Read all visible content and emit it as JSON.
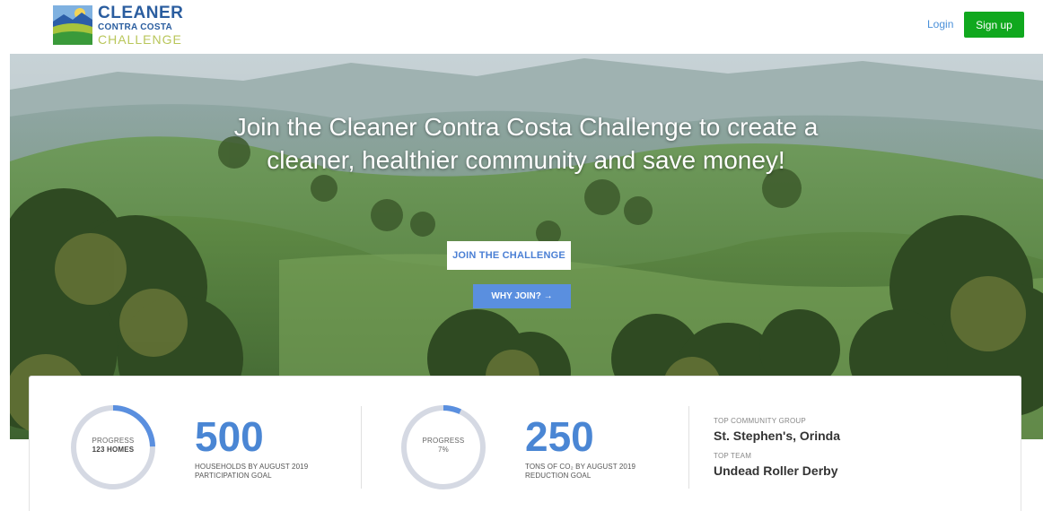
{
  "logo": {
    "line1": "CLEANER",
    "line2": "CONTRA COSTA",
    "line3": "CHALLENGE"
  },
  "nav": {
    "login_label": "Login",
    "signup_label": "Sign up"
  },
  "hero": {
    "title": "Join the Cleaner Contra Costa Challenge to create a cleaner, healthier community and save money!",
    "join_label": "JOIN THE CHALLENGE",
    "why_label": "WHY JOIN? →"
  },
  "stats": {
    "households": {
      "progress_label": "PROGRESS",
      "progress_value": "123 HOMES",
      "progress_fraction": 0.246,
      "goal_number": "500",
      "goal_line1": "HOUSEHOLDS BY AUGUST 2019",
      "goal_line2": "PARTICIPATION GOAL"
    },
    "emissions": {
      "progress_label": "PROGRESS",
      "progress_value": "7%",
      "progress_fraction": 0.07,
      "goal_number": "250",
      "goal_line1": "TONS OF CO₂ BY AUGUST 2019",
      "goal_line2": "REDUCTION GOAL"
    },
    "leaders": {
      "group_label": "TOP COMMUNITY GROUP",
      "group_value": "St. Stephen's, Orinda",
      "team_label": "TOP TEAM",
      "team_value": "Undead Roller Derby"
    }
  },
  "colors": {
    "accent_blue": "#4a86d4",
    "signup_green": "#10a81e",
    "ring_track": "#d5d9e3",
    "ring_fill": "#5a8fdf"
  }
}
